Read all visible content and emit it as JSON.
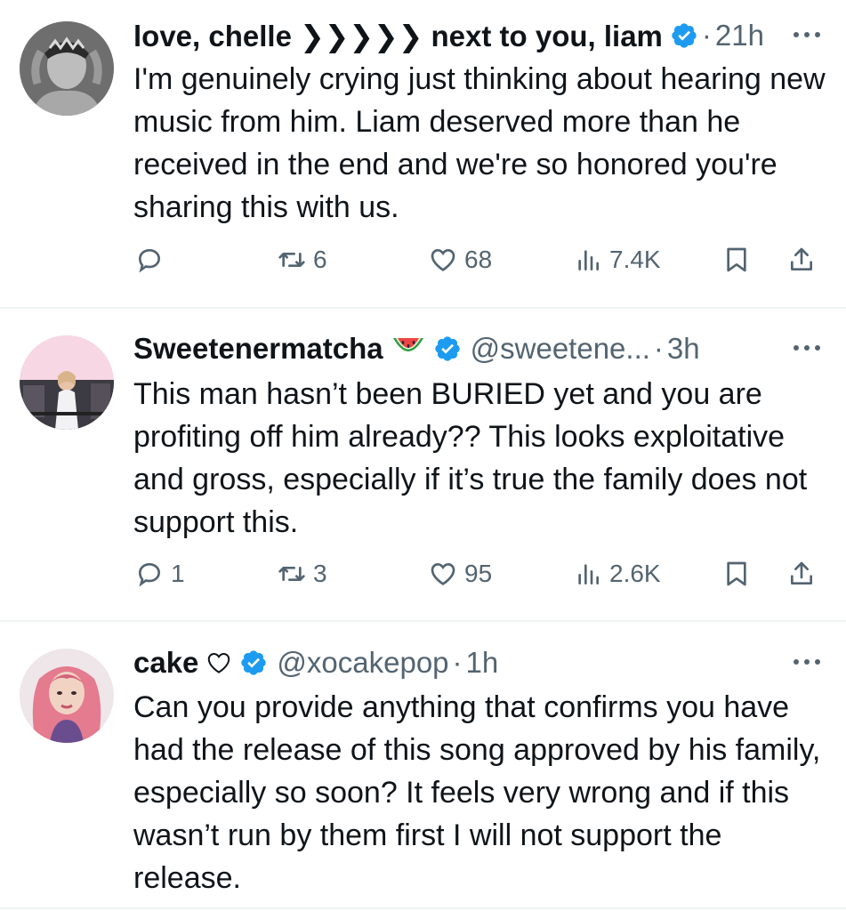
{
  "tweets": [
    {
      "display_name": "love, chelle ❯❯❯❯❯ next to you, liam",
      "handle": "",
      "separator": "·",
      "time": "21h",
      "text": "I'm genuinely crying just thinking about hearing new music from him. Liam deserved more than he received in the end and we're so honored you're sharing this with us.",
      "counts": {
        "replies": "",
        "reposts": "6",
        "likes": "68",
        "views": "7.4K"
      },
      "avatar_icon": "avatar-photo-icon"
    },
    {
      "display_name": "Sweetenermatcha",
      "handle": "@sweetene...",
      "separator": "·",
      "time": "3h",
      "text": "This man hasn’t been BURIED yet and you are profiting off him already?? This looks exploitative and gross, especially if it’s true the family does not support this.",
      "counts": {
        "replies": "1",
        "reposts": "3",
        "likes": "95",
        "views": "2.6K"
      },
      "name_emoji": "watermelon-icon",
      "avatar_icon": "avatar-photo-icon"
    },
    {
      "display_name": "cake",
      "handle": "@xocakepop",
      "separator": "·",
      "time": "1h",
      "text": "Can you provide anything that confirms you have had the release of this song approved by his family, especially so soon? It feels very wrong and if this wasn’t run by them first I will not support the release.",
      "name_emoji": "heart-outline-icon",
      "avatar_icon": "avatar-photo-icon"
    }
  ],
  "colors": {
    "text": "#0f1419",
    "secondary": "#536471",
    "verified_blue": "#1d9bf0",
    "divider": "#eff3f4"
  }
}
